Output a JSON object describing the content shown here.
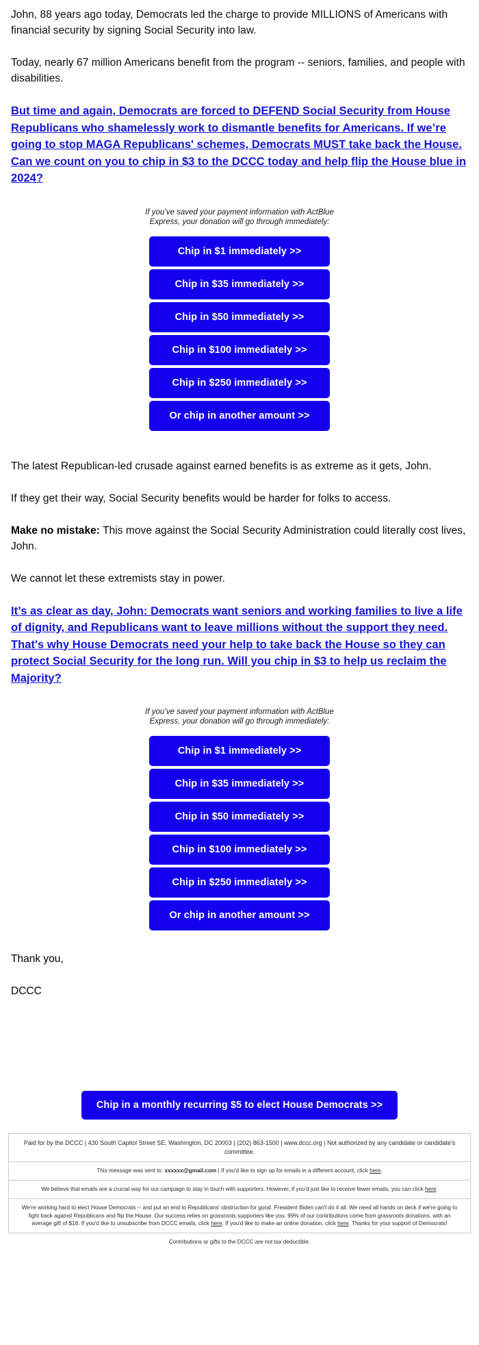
{
  "colors": {
    "button_blue": "#1500ee",
    "link_blue": "#1414d6",
    "text_black": "#0b0b0b",
    "footer_gray": "#2b2b2b"
  },
  "intro": {
    "para1": "John, 88 years ago today, Democrats led the charge to provide MILLIONS of Americans with financial security by signing Social Security into law.",
    "para2": "Today, nearly 67 million Americans benefit from the program -- seniors, families, and people with disabilities.",
    "link1": "But time and again, Democrats are forced to DEFEND Social Security from House Republicans who shamelessly work to dismantle benefits for Americans. If we’re going to stop MAGA Republicans' schemes, Democrats MUST take back the House. Can we count on you to chip in $3 to the DCCC today and help flip the House blue in 2024?"
  },
  "ask_block_1": {
    "actblue_note": "If you’ve saved your payment information with ActBlue Express, your donation will go through immediately:",
    "buttons": [
      "Chip in $1 immediately >>",
      "Chip in $35 immediately >>",
      "Chip in $50 immediately >>",
      "Chip in $100 immediately >>",
      "Chip in $250 immediately >>",
      "Or chip in another amount >>"
    ]
  },
  "middle": {
    "para1": "The latest Republican-led crusade against earned benefits is as extreme as it gets, John.",
    "para2": "If they get their way, Social Security benefits would be harder for folks to access.",
    "para3_bold": "Make no mistake:",
    "para3_rest": " This move against the Social Security Administration could literally cost lives, John.",
    "para4": "We cannot let these extremists stay in power.",
    "link2": "It’s as clear as day, John: Democrats want seniors and working families to live a life of dignity, and Republicans want to leave millions without the support they need. That's why House Democrats need your help to take back the House so they can protect Social Security for the long run. Will you chip in $3 to help us reclaim the Majority?"
  },
  "ask_block_2": {
    "actblue_note": "If you’ve saved your payment information with ActBlue Express, your donation will go through immediately:",
    "buttons": [
      "Chip in $1 immediately >>",
      "Chip in $35 immediately >>",
      "Chip in $50 immediately >>",
      "Chip in $100 immediately >>",
      "Chip in $250 immediately >>",
      "Or chip in another amount >>"
    ]
  },
  "signoff": {
    "thanks": "Thank you,",
    "name": "DCCC"
  },
  "monthly": {
    "label": "Chip in a monthly recurring $5 to elect House Democrats >>"
  },
  "footer": {
    "paid_for": "Paid for by the DCCC | 430 South Capitol Street SE, Washington, DC 20003 | (202) 863-1500 | www.dccc.org | Not authorized by any candidate or candidate's committee.",
    "sent_to_prefix": "This message was sent to: ",
    "sent_to_email": "xxxxxx@gmail.com",
    "sent_to_suffix": " | If you'd like to sign up for emails in a different account, click ",
    "sent_to_link": "here",
    "sent_to_end": ".",
    "crucial_text": "We believe that emails are a crucial way for our campaign to stay in touch with supporters. However, if you'd just like to receive fewer emails, you can click ",
    "crucial_link": "here",
    "crucial_end": ".",
    "long_text_a": "We're working hard to elect House Democrats -- and put an end to Republicans' obstruction for good. President Biden can't do it all. We need all hands on deck if we're going to fight back against Republicans and flip the House. Our success relies on grassroots supporters like you. 99% of our contributions come from grassroots donations, with an average gift of $18. If you'd like to unsubscribe from DCCC emails, click ",
    "long_link_a": "here",
    "long_text_b": ". If you'd like to make an online donation, click ",
    "long_link_b": "here",
    "long_text_c": ". Thanks for your support of Democrats!",
    "tax_note": "Contributions or gifts to the DCCC are not tax deductible."
  }
}
